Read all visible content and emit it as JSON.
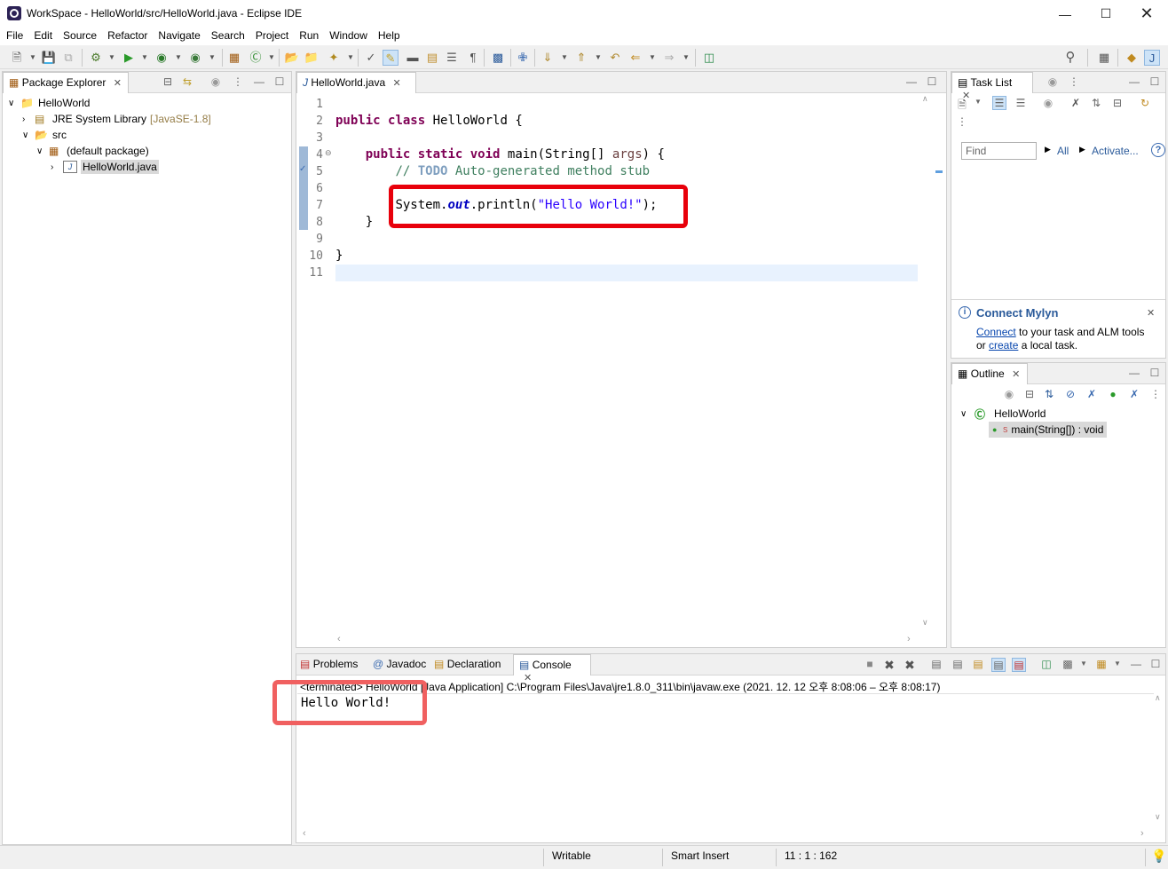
{
  "window": {
    "title": "WorkSpace - HelloWorld/src/HelloWorld.java - Eclipse IDE"
  },
  "menu": [
    "File",
    "Edit",
    "Source",
    "Refactor",
    "Navigate",
    "Search",
    "Project",
    "Run",
    "Window",
    "Help"
  ],
  "package_explorer": {
    "tab_label": "Package Explorer",
    "tree": {
      "project": "HelloWorld",
      "jre": "JRE System Library",
      "jre_version": "[JavaSE-1.8]",
      "src": "src",
      "package": "(default package)",
      "file": "HelloWorld.java"
    }
  },
  "editor": {
    "tab_label": "HelloWorld.java",
    "line_numbers": [
      "1",
      "2",
      "3",
      "4",
      "5",
      "6",
      "7",
      "8",
      "9",
      "10",
      "11"
    ],
    "code": {
      "l2_kw1": "public",
      "l2_kw2": "class",
      "l2_rest": " HelloWorld {",
      "l4_kw1": "public",
      "l4_kw2": "static",
      "l4_kw3": "void",
      "l4_mid": " main(String[] ",
      "l4_param": "args",
      "l4_end": ") {",
      "l5_slashes": "// ",
      "l5_todo": "TODO",
      "l5_comment": " Auto-generated method stub",
      "l7_a": "System.",
      "l7_field": "out",
      "l7_b": ".println(",
      "l7_str": "\"Hello World!\"",
      "l7_c": ");",
      "l8": "}",
      "l10": "}"
    }
  },
  "task_list": {
    "tab_label": "Task List",
    "find_placeholder": "Find",
    "all_label": "All",
    "activate_label": "Activate...",
    "mylyn_title": "Connect Mylyn",
    "mylyn_connect": "Connect",
    "mylyn_text1": " to your task and ALM tools",
    "mylyn_or": "or ",
    "mylyn_create": "create",
    "mylyn_text2": " a local task."
  },
  "outline": {
    "tab_label": "Outline",
    "class_name": "HelloWorld",
    "method": "main(String[]) : void"
  },
  "bottom_tabs": {
    "problems": "Problems",
    "javadoc": "Javadoc",
    "declaration": "Declaration",
    "console": "Console"
  },
  "console": {
    "header": "<terminated> HelloWorld [Java Application] C:\\Program Files\\Java\\jre1.8.0_311\\bin\\javaw.exe  (2021. 12. 12 오후 8:08:06 – 오후 8:08:17)",
    "output": "Hello World!"
  },
  "status": {
    "writable": "Writable",
    "insert_mode": "Smart Insert",
    "position": "11 : 1 : 162"
  },
  "colors": {
    "highlight_red": "#e8000b",
    "highlight_red_light": "#f06060",
    "keyword": "#7f0055",
    "string": "#2a00ff",
    "comment": "#3f7f5f"
  }
}
